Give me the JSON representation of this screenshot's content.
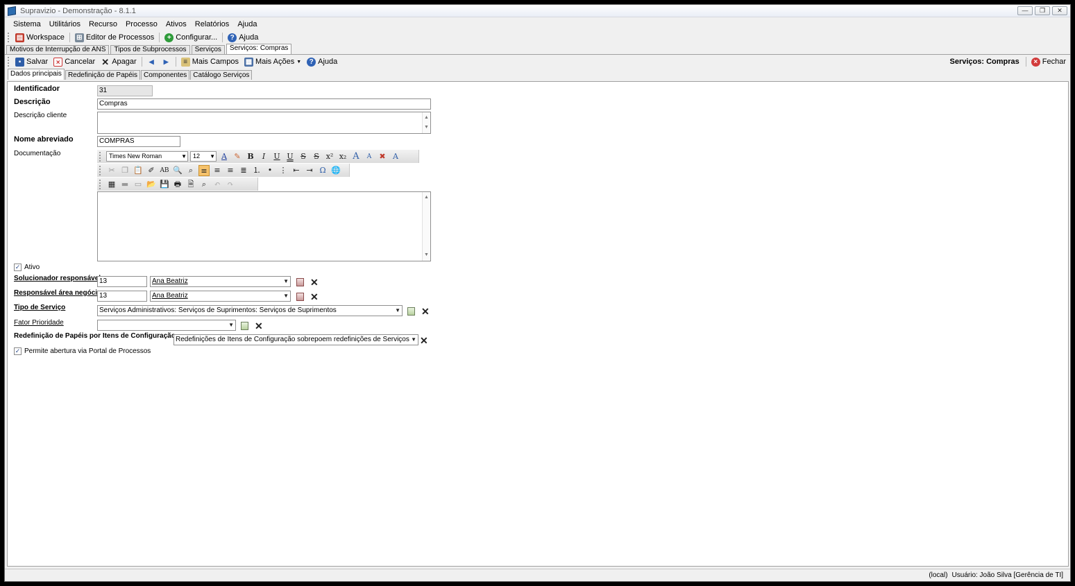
{
  "window": {
    "title": "Supravizio - Demonstração - 8.1.1",
    "controls": [
      "—",
      "❐",
      "✕"
    ]
  },
  "menu": [
    "Sistema",
    "Utilitários",
    "Recurso",
    "Processo",
    "Ativos",
    "Relatórios",
    "Ajuda"
  ],
  "main_toolbar": {
    "workspace": "Workspace",
    "editor": "Editor de Processos",
    "configurar": "Configurar...",
    "ajuda": "Ajuda"
  },
  "doc_tabs": [
    "Motivos de Interrupção de ANS",
    "Tipos de Subprocessos",
    "Serviços",
    "Serviços: Compras"
  ],
  "form_toolbar": {
    "salvar": "Salvar",
    "cancelar": "Cancelar",
    "apagar": "Apagar",
    "mais_campos": "Mais Campos",
    "mais_acoes": "Mais Ações",
    "ajuda": "Ajuda",
    "context_title": "Serviços: Compras",
    "fechar": "Fechar"
  },
  "sub_tabs": [
    "Dados principais",
    "Redefinição de Papéis",
    "Componentes",
    "Catálogo Serviços"
  ],
  "form": {
    "identificador_label": "Identificador",
    "identificador_value": "31",
    "descricao_label": "Descrição",
    "descricao_value": "Compras",
    "descricao_cliente_label": "Descrição cliente",
    "nome_abreviado_label": "Nome abreviado",
    "nome_abreviado_value": "COMPRAS",
    "documentacao_label": "Documentação",
    "rte_font": "Times New Roman",
    "rte_size": "12",
    "ativo_label": "Ativo",
    "ativo_checked": true,
    "solucionador_label": "Solucionador responsável",
    "solucionador_code": "13",
    "solucionador_name": "Ana Beatriz",
    "responsavel_label": "Responsável área negócio",
    "responsavel_code": "13",
    "responsavel_name": "Ana Beatriz",
    "tipo_servico_label": "Tipo de Serviço",
    "tipo_servico_value": "Serviços Administrativos: Serviços de Suprimentos: Serviços de Suprimentos",
    "fator_prioridade_label": "Fator Prioridade",
    "fator_prioridade_value": "",
    "redefinicao_label": "Redefinição de Papéis por Itens de Configuração",
    "redefinicao_value": "Redefinições de Itens de Configuração sobrepoem redefinições de Serviços",
    "permite_label": "Permite abertura via Portal de Processos",
    "permite_checked": true
  },
  "status": {
    "server": "(local)",
    "user": "Usuário: João Silva [Gerência de TI]"
  }
}
